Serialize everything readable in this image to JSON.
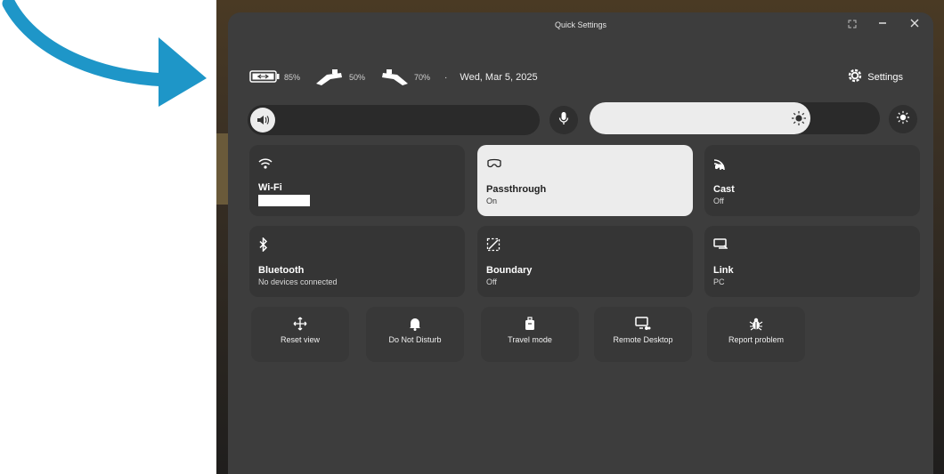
{
  "window": {
    "title": "Quick Settings",
    "expand_icon": "expand-icon",
    "minimize_icon": "minimize-icon",
    "close_icon": "close-icon"
  },
  "status": {
    "headset_battery": "85%",
    "left_controller_battery": "50%",
    "right_controller_battery": "70%",
    "separator": "·",
    "date": "Wed, Mar 5, 2025",
    "settings_label": "Settings"
  },
  "sliders": {
    "volume_icon": "volume-icon",
    "volume_level": 0,
    "mic_icon": "microphone-icon",
    "brightness_icon": "brightness-icon",
    "brightness_level": 0.95
  },
  "tiles": [
    {
      "id": "wifi",
      "label": "Wi-Fi",
      "sub": "",
      "icon": "wifi-icon",
      "on": false
    },
    {
      "id": "passthrough",
      "label": "Passthrough",
      "sub": "On",
      "icon": "passthrough-icon",
      "on": true
    },
    {
      "id": "cast",
      "label": "Cast",
      "sub": "Off",
      "icon": "cast-icon",
      "on": false
    },
    {
      "id": "bluetooth",
      "label": "Bluetooth",
      "sub": "No devices connected",
      "icon": "bluetooth-icon",
      "on": false
    },
    {
      "id": "boundary",
      "label": "Boundary",
      "sub": "Off",
      "icon": "boundary-icon",
      "on": false
    },
    {
      "id": "link",
      "label": "Link",
      "sub": "PC",
      "icon": "link-icon",
      "on": false
    }
  ],
  "quick_actions": [
    {
      "label": "Reset view",
      "icon": "move-icon"
    },
    {
      "label": "Do Not Disturb",
      "icon": "bell-icon"
    },
    {
      "label": "Travel mode",
      "icon": "luggage-icon"
    },
    {
      "label": "Remote Desktop",
      "icon": "remote-desktop-icon"
    },
    {
      "label": "Report problem",
      "icon": "bug-icon"
    }
  ],
  "colors": {
    "arrow": "#1e96c8",
    "panel": "#3d3d3d",
    "tile": "#353535",
    "tile_on": "#ececec"
  }
}
